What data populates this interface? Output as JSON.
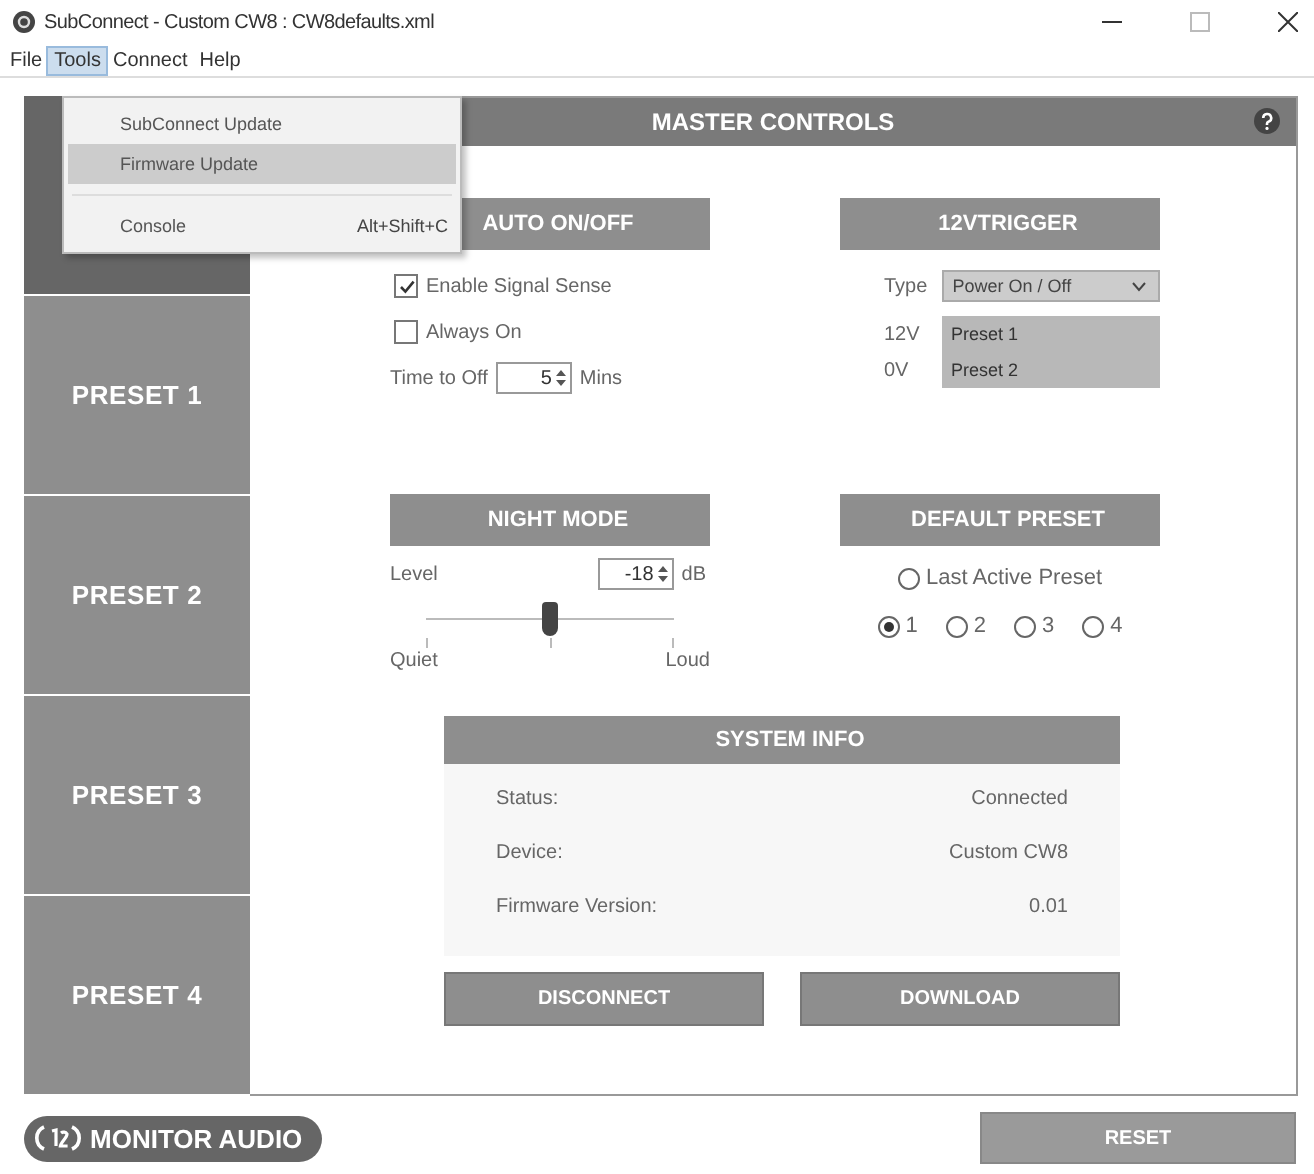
{
  "window": {
    "title": "SubConnect - Custom CW8 : CW8defaults.xml"
  },
  "menu_bar": [
    {
      "label": "File",
      "selected": false
    },
    {
      "label": "Tools",
      "selected": true
    },
    {
      "label": "Connect",
      "selected": false
    },
    {
      "label": "Help",
      "selected": false
    }
  ],
  "tools_menu": [
    {
      "label": "SubConnect Update",
      "highlighted": false,
      "separator_before": false
    },
    {
      "label": "Firmware Update",
      "highlighted": true,
      "separator_before": false
    },
    {
      "label": "Console",
      "shortcut": "Alt+Shift+C",
      "highlighted": false,
      "separator_before": true
    }
  ],
  "sidebar": [
    {
      "selected": true
    },
    {
      "label": "PRESET 1",
      "selected": false
    },
    {
      "label": "PRESET 2",
      "selected": false
    },
    {
      "label": "PRESET 3",
      "selected": false
    },
    {
      "label": "PRESET 4",
      "selected": false
    }
  ],
  "header": "MASTER CONTROLS",
  "auto_on_off": {
    "title": "AUTO ON/OFF",
    "options": [
      {
        "label": "Enable Signal Sense",
        "checked": true
      },
      {
        "label": "Always On",
        "checked": false
      }
    ],
    "time_to_off": {
      "label": "Time to Off",
      "value": "5",
      "unit": "Mins"
    }
  },
  "trigger": {
    "title": "12VTRIGGER",
    "type_label": "Type",
    "type_value": "Power On / Off",
    "rows": [
      {
        "label": "12V",
        "value": "Preset 1"
      },
      {
        "label": "0V",
        "value": "Preset 2"
      }
    ]
  },
  "night_mode": {
    "title": "NIGHT MODE",
    "level_label": "Level",
    "value": "-18",
    "unit": "dB",
    "level": 0.5,
    "min_label": "Quiet",
    "max_label": "Loud"
  },
  "default_preset": {
    "title": "DEFAULT PRESET",
    "last_active": {
      "label": "Last Active Preset",
      "selected": false
    },
    "presets": [
      {
        "label": "1",
        "selected": true
      },
      {
        "label": "2",
        "selected": false
      },
      {
        "label": "3",
        "selected": false
      },
      {
        "label": "4",
        "selected": false
      }
    ]
  },
  "system_info": {
    "title": "SYSTEM INFO",
    "rows": [
      {
        "label": "Status:",
        "value": "Connected"
      },
      {
        "label": "Device:",
        "value": "Custom CW8"
      },
      {
        "label": "Firmware Version:",
        "value": "0.01"
      }
    ]
  },
  "buttons": [
    "DISCONNECT",
    "DOWNLOAD"
  ],
  "logo": "MONITOR AUDIO",
  "reset": "RESET"
}
